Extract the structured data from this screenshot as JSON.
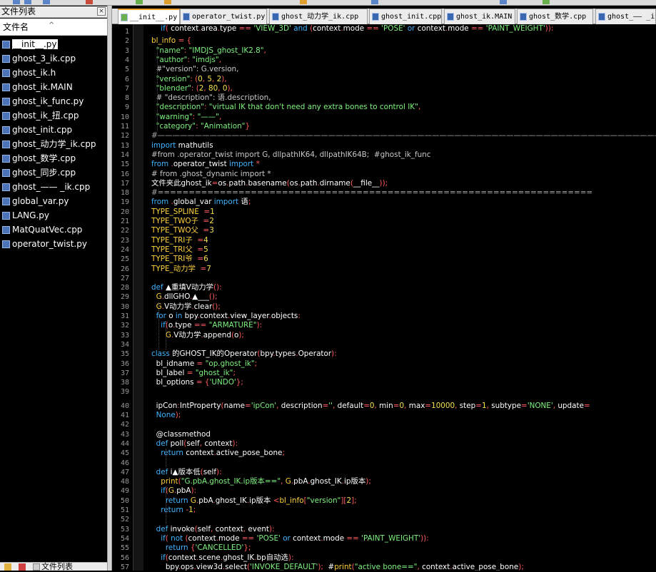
{
  "sidebar": {
    "title": "文件列表",
    "close": "×",
    "column": "文件名",
    "caret": "^",
    "files": [
      "__init__.py",
      "ghost_3_ik.cpp",
      "ghost_ik.h",
      "ghost_ik.MAIN",
      "ghost_ik_func.py",
      "ghost_ik_扭.cpp",
      "ghost_init.cpp",
      "ghost_动力学_ik.cpp",
      "ghost_数学.cpp",
      "ghost_同步.cpp",
      "ghost_—— _ik.cpp",
      "global_var.py",
      "LANG.py",
      "MatQuatVec.cpp",
      "operator_twist.py"
    ],
    "footer": "文件列表"
  },
  "tabs": [
    "__init__.py",
    "operator_twist.py",
    "ghost_动力学_ik.cpp",
    "ghost_init.cpp",
    "ghost_ik.MAIN",
    "ghost_数学.cpp",
    "ghost_—— _i"
  ],
  "colors": {
    "keyword": "#3fb4ff",
    "string": "#7ef27e",
    "number": "#f5e04e",
    "operator": "#ff5a5a",
    "background": "#000000"
  },
  "code": {
    "line_numbers": [
      "1",
      "2",
      "3",
      "4",
      "5",
      "6",
      "7",
      "8",
      "9",
      "10",
      "11",
      "12",
      "13",
      "14",
      "15",
      "16",
      "17",
      "18",
      "19",
      "20",
      "21",
      "22",
      "23",
      "24",
      "25",
      "26",
      "27",
      "28",
      "29",
      "30",
      "31",
      "32",
      "33",
      "34",
      "35",
      "36",
      "37",
      "38",
      "39",
      "40",
      "41",
      "42",
      "43",
      "44",
      "45",
      "46",
      "47",
      "48",
      "49",
      "50",
      "51",
      "52",
      "53",
      "54",
      "55",
      "56",
      "57"
    ],
    "lines": [
      "",
      "bl_info = {",
      "  \"name\": \"IMDJS_ghost_IK2.8\",",
      "  \"author\": \"imdjs\",",
      "  #\"version\": G.version,",
      "  \"version\": (0, 5, 2),",
      "  \"blender\": (2, 80, 0),",
      "  # \"description\": 语.description,",
      "  \"description\": \"virtual IK that don't need any extra bones to control IK\",",
      "  \"warning\": \"——\",",
      "  \"category\": \"Animation\"}",
      "#——————————————————————————————————————————————————————————————————————",
      "import mathutils",
      "#from .operator_twist import G, dllpathIK64, dllpathIK64B;  #ghost_ik_func",
      "from .operator_twist import *",
      "# from .ghost_dynamic import *",
      "文件夹此ghost_ik=os.path.basename(os.path.dirname(__file__));",
      "#======================================================================",
      "from .global_var import 语;",
      "TYPE_SPLINE  =1",
      "TYPE_TWO子  =2",
      "TYPE_TWO父  =3",
      "TYPE_TRI子  =4",
      "TYPE_TRI父  =5",
      "TYPE_TRI爷  =6",
      "TYPE_动力学  =7",
      "",
      "def ▲重填V动力学():",
      "  G.dllGHO.▲___();",
      "  G.V动力学.clear();",
      "  for o in bpy.context.view_layer.objects:",
      "    if(o.type == \"ARMATURE\"):",
      "      G.V动力学.append(o);",
      "",
      "class 的GHOST_IK的Operator(bpy.types.Operator):",
      "  bl_idname = \"op.ghost_ik\";",
      "  bl_label = \"ghost_ik\";",
      "  bl_options = {'UNDO'};",
      "",
      "  ipCon:IntProperty(name='ipCon', description='', default=0, min=0, max=10000, step=1, subtype='NONE', update=",
      "  None);",
      "",
      "  @classmethod",
      "  def poll(self, context):",
      "    return context.active_pose_bone;",
      "",
      "  def i▲版本低(self):",
      "    print(\"G.pbA.ghost_IK.ip版本==\", G.pbA.ghost_IK.ip版本);",
      "    if(G.pbA):",
      "      return G.pbA.ghost_IK.ip版本 <bl_info[\"version\"][2];",
      "    return -1;",
      "",
      "  def invoke(self, context, event):",
      "    if( not (context.mode == 'POSE' or context.mode == 'PAINT_WEIGHT')):",
      "      return {'CANCELLED'};",
      "    if(context.scene.ghost_IK.bp自动选):",
      "      bpy.ops.view3d.select('INVOKE_DEFAULT');  #print(\"active bone==\", context.active_pose_bone);",
      "    if( context.area.type == 'VIEW_3D' and (context.mode == 'POSE' or context.mode == 'PAINT_WEIGHT')):"
    ]
  }
}
